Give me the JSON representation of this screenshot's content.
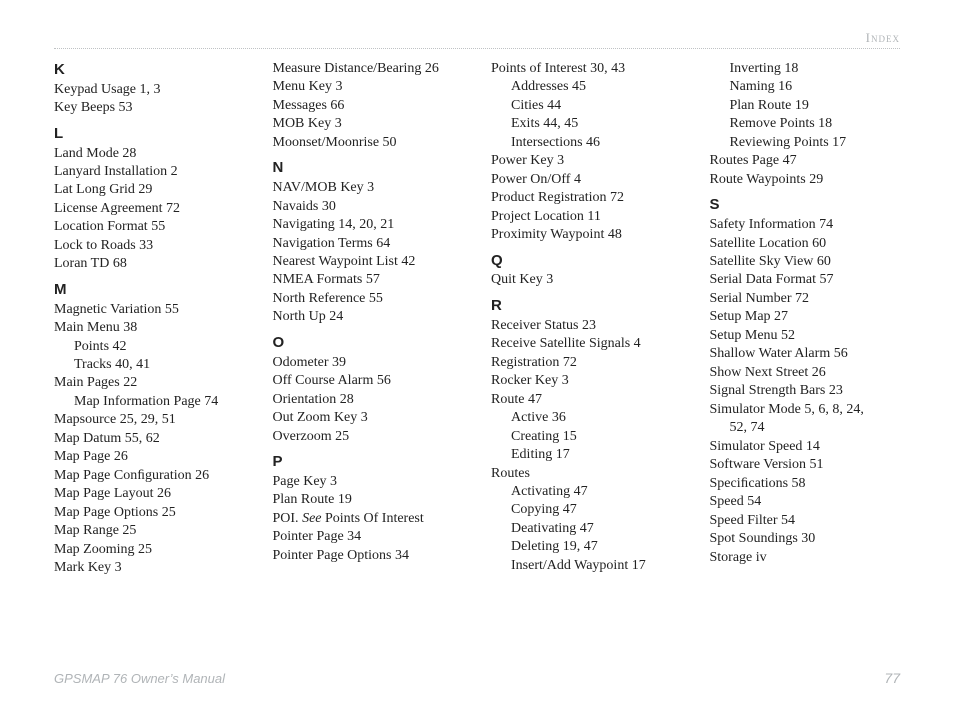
{
  "header_label": "Index",
  "footer_left": "GPSMAP 76 Owner’s Manual",
  "footer_right": "77",
  "columns": [
    [
      {
        "type": "letter",
        "text": "K"
      },
      {
        "type": "entry",
        "text": "Keypad Usage  1, 3"
      },
      {
        "type": "entry",
        "text": "Key Beeps  53"
      },
      {
        "type": "letter",
        "text": "L"
      },
      {
        "type": "entry",
        "text": "Land Mode  28"
      },
      {
        "type": "entry",
        "text": "Lanyard Installation  2"
      },
      {
        "type": "entry",
        "text": "Lat Long Grid  29"
      },
      {
        "type": "entry",
        "text": "License Agreement  72"
      },
      {
        "type": "entry",
        "text": "Location Format  55"
      },
      {
        "type": "entry",
        "text": "Lock to Roads  33"
      },
      {
        "type": "entry",
        "text": "Loran TD  68"
      },
      {
        "type": "letter",
        "text": "M"
      },
      {
        "type": "entry",
        "text": "Magnetic Variation  55"
      },
      {
        "type": "entry",
        "text": "Main Menu  38"
      },
      {
        "type": "sub",
        "text": "Points  42"
      },
      {
        "type": "sub",
        "text": "Tracks  40, 41"
      },
      {
        "type": "entry",
        "text": "Main Pages  22"
      },
      {
        "type": "sub",
        "text": "Map Information Page  74"
      },
      {
        "type": "entry",
        "text": "Mapsource  25, 29, 51"
      },
      {
        "type": "entry",
        "text": "Map Datum  55, 62"
      },
      {
        "type": "entry",
        "text": "Map Page  26"
      },
      {
        "type": "entry",
        "text": "Map Page Conﬁguration  26"
      },
      {
        "type": "entry",
        "text": "Map Page Layout  26"
      },
      {
        "type": "entry",
        "text": "Map Page Options  25"
      },
      {
        "type": "entry",
        "text": "Map Range  25"
      },
      {
        "type": "entry",
        "text": "Map Zooming  25"
      },
      {
        "type": "entry",
        "text": "Mark Key  3"
      }
    ],
    [
      {
        "type": "entry",
        "text": "Measure Distance/Bearing  26"
      },
      {
        "type": "entry",
        "text": "Menu Key  3"
      },
      {
        "type": "entry",
        "text": "Messages  66"
      },
      {
        "type": "entry",
        "text": "MOB Key  3"
      },
      {
        "type": "entry",
        "text": "Moonset/Moonrise  50"
      },
      {
        "type": "letter",
        "text": "N"
      },
      {
        "type": "entry",
        "text": "NAV/MOB Key  3"
      },
      {
        "type": "entry",
        "text": "Navaids  30"
      },
      {
        "type": "entry",
        "text": "Navigating  14, 20, 21"
      },
      {
        "type": "entry",
        "text": "Navigation Terms  64"
      },
      {
        "type": "entry",
        "text": "Nearest Waypoint List  42"
      },
      {
        "type": "entry",
        "text": "NMEA Formats  57"
      },
      {
        "type": "entry",
        "text": "North Reference  55"
      },
      {
        "type": "entry",
        "text": "North Up  24"
      },
      {
        "type": "letter",
        "text": "O"
      },
      {
        "type": "entry",
        "text": "Odometer  39"
      },
      {
        "type": "entry",
        "text": "Off Course Alarm  56"
      },
      {
        "type": "entry",
        "text": "Orientation  28"
      },
      {
        "type": "entry",
        "text": "Out Zoom Key  3"
      },
      {
        "type": "entry",
        "text": "Overzoom  25"
      },
      {
        "type": "letter",
        "text": "P"
      },
      {
        "type": "entry",
        "text": "Page Key  3"
      },
      {
        "type": "entry",
        "text": "Plan Route  19"
      },
      {
        "type": "entry_html",
        "html": "POI. <em class=\"see\">See</em> Points Of Interest"
      },
      {
        "type": "entry",
        "text": "Pointer Page  34"
      },
      {
        "type": "entry",
        "text": "Pointer Page Options  34"
      }
    ],
    [
      {
        "type": "entry",
        "text": "Points of Interest  30, 43"
      },
      {
        "type": "sub",
        "text": "Addresses  45"
      },
      {
        "type": "sub",
        "text": "Cities  44"
      },
      {
        "type": "sub",
        "text": "Exits  44, 45"
      },
      {
        "type": "sub",
        "text": "Intersections  46"
      },
      {
        "type": "entry",
        "text": "Power Key  3"
      },
      {
        "type": "entry",
        "text": "Power On/Off  4"
      },
      {
        "type": "entry",
        "text": "Product Registration  72"
      },
      {
        "type": "entry",
        "text": "Project Location  11"
      },
      {
        "type": "entry",
        "text": "Proximity Waypoint  48"
      },
      {
        "type": "letter",
        "text": "Q"
      },
      {
        "type": "entry",
        "text": "Quit Key  3"
      },
      {
        "type": "letter",
        "text": "R"
      },
      {
        "type": "entry",
        "text": "Receiver Status  23"
      },
      {
        "type": "entry",
        "text": "Receive Satellite Signals  4"
      },
      {
        "type": "entry",
        "text": "Registration  72"
      },
      {
        "type": "entry",
        "text": "Rocker Key  3"
      },
      {
        "type": "entry",
        "text": "Route  47"
      },
      {
        "type": "sub",
        "text": "Active  36"
      },
      {
        "type": "sub",
        "text": "Creating  15"
      },
      {
        "type": "sub",
        "text": "Editing  17"
      },
      {
        "type": "entry",
        "text": "Routes"
      },
      {
        "type": "sub",
        "text": "Activating  47"
      },
      {
        "type": "sub",
        "text": "Copying  47"
      },
      {
        "type": "sub",
        "text": "Deativating  47"
      },
      {
        "type": "sub",
        "text": "Deleting  19, 47"
      },
      {
        "type": "sub",
        "text": "Insert/Add Waypoint  17"
      }
    ],
    [
      {
        "type": "sub",
        "text": "Inverting  18"
      },
      {
        "type": "sub",
        "text": "Naming  16"
      },
      {
        "type": "sub",
        "text": "Plan Route  19"
      },
      {
        "type": "sub",
        "text": "Remove Points  18"
      },
      {
        "type": "sub",
        "text": "Reviewing Points  17"
      },
      {
        "type": "entry",
        "text": "Routes Page  47"
      },
      {
        "type": "entry",
        "text": "Route Waypoints  29"
      },
      {
        "type": "letter",
        "text": "S"
      },
      {
        "type": "entry",
        "text": "Safety Information  74"
      },
      {
        "type": "entry",
        "text": "Satellite Location  60"
      },
      {
        "type": "entry",
        "text": "Satellite Sky View  60"
      },
      {
        "type": "entry",
        "text": "Serial Data Format  57"
      },
      {
        "type": "entry",
        "text": "Serial Number  72"
      },
      {
        "type": "entry",
        "text": "Setup Map  27"
      },
      {
        "type": "entry",
        "text": "Setup Menu  52"
      },
      {
        "type": "entry",
        "text": "Shallow Water Alarm  56"
      },
      {
        "type": "entry",
        "text": "Show Next Street  26"
      },
      {
        "type": "entry",
        "text": "Signal Strength Bars  23"
      },
      {
        "type": "entry",
        "text": "Simulator Mode  5, 6, 8, 24,"
      },
      {
        "type": "sub2",
        "text": "52, 74"
      },
      {
        "type": "entry",
        "text": "Simulator Speed  14"
      },
      {
        "type": "entry",
        "text": "Software Version  51"
      },
      {
        "type": "entry",
        "text": "Speciﬁcations  58"
      },
      {
        "type": "entry",
        "text": "Speed  54"
      },
      {
        "type": "entry",
        "text": "Speed Filter  54"
      },
      {
        "type": "entry",
        "text": "Spot Soundings  30"
      },
      {
        "type": "entry",
        "text": "Storage  iv"
      }
    ]
  ]
}
